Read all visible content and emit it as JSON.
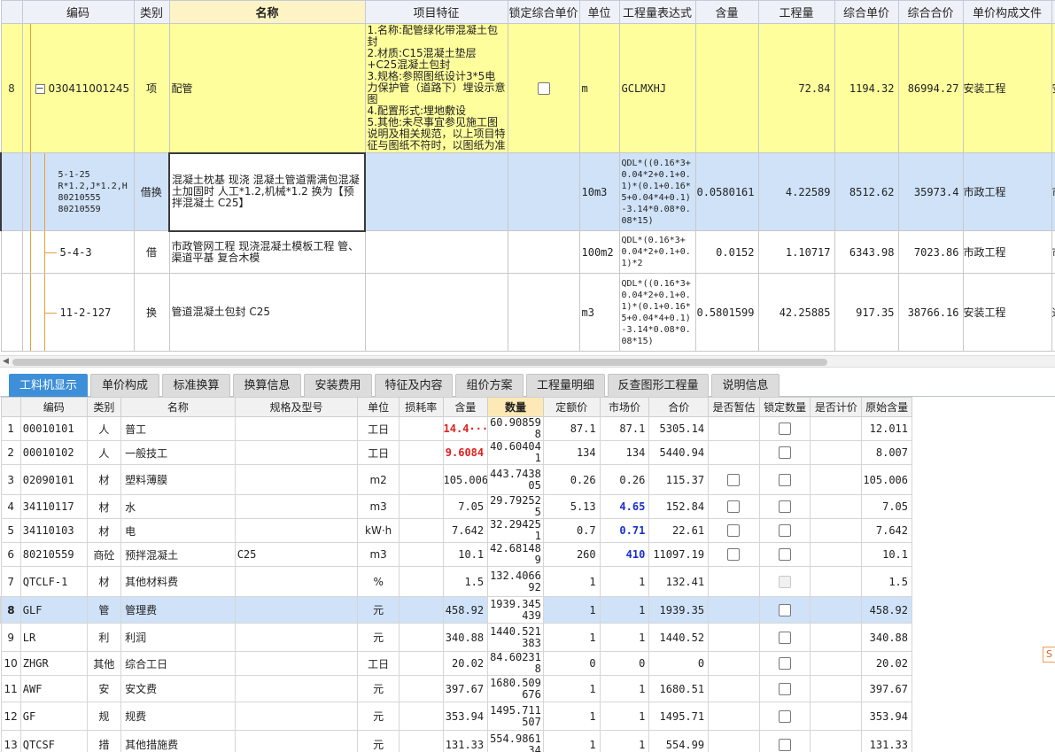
{
  "upper": {
    "headers": [
      "编码",
      "类别",
      "名称",
      "项目特征",
      "锁定综合单价",
      "单位",
      "工程量表达式",
      "含量",
      "工程量",
      "综合单价",
      "综合合价",
      "单价构成文件"
    ],
    "rows": [
      {
        "num": "8",
        "code": "030411001245",
        "category": "项",
        "name": "配管",
        "feature": "1.名称:配管绿化带混凝土包封\n2.材质:C15混凝土垫层+C25混凝土包封\n3.规格:参照图纸设计3*5电力保护管（道路下）埋设示意图\n4.配置形式:埋地敷设\n5.其他:未尽事宜参见施工图说明及相关规范，以上项目特征与图纸不符时，以图纸为准",
        "unit": "m",
        "expr": "GCLMXHJ",
        "content": "",
        "qty": "72.84",
        "price": "1194.32",
        "total": "86994.27",
        "file": "安装工程",
        "extra": "安"
      },
      {
        "num": "",
        "code": "5-1-25\nR*1.2,J*1.2,H\n80210555\n80210559",
        "category": "借换",
        "name": "混凝土枕基 现浇 混凝土管道需满包混凝土加固时 人工*1.2,机械*1.2 换为【预拌混凝土 C25】",
        "feature": "",
        "unit": "10m3",
        "expr": "QDL*((0.16*3+0.04*2+0.1+0.1)*(0.1+0.16*5+0.04*4+0.1)-3.14*0.08*0.08*15)",
        "content": "0.0580161",
        "qty": "4.22589",
        "price": "8512.62",
        "total": "35973.4",
        "file": "市政工程",
        "extra": "市"
      },
      {
        "num": "",
        "code": "5-4-3",
        "category": "借",
        "name": "市政管网工程 现浇混凝土模板工程 管、渠道平基 复合木模",
        "feature": "",
        "unit": "100m2",
        "expr": "QDL*(0.16*3+0.04*2+0.1+0.1)*2",
        "content": "0.0152",
        "qty": "1.10717",
        "price": "6343.98",
        "total": "7023.86",
        "file": "市政工程",
        "extra": "市"
      },
      {
        "num": "",
        "code": "11-2-127",
        "category": "换",
        "name": "管道混凝土包封 C25",
        "feature": "",
        "unit": "m3",
        "expr": "QDL*((0.16*3+0.04*2+0.1+0.1)*(0.1+0.16*5+0.04*4+0.1)-3.14*0.08*0.08*15)",
        "content": "0.5801599",
        "qty": "42.25885",
        "price": "917.35",
        "total": "38766.16",
        "file": "安装工程",
        "extra": "通"
      }
    ]
  },
  "tabs": [
    "工料机显示",
    "单价构成",
    "标准换算",
    "换算信息",
    "安装费用",
    "特征及内容",
    "组价方案",
    "工程量明细",
    "反查图形工程量",
    "说明信息"
  ],
  "lower": {
    "headers": [
      "编码",
      "类别",
      "名称",
      "规格及型号",
      "单位",
      "损耗率",
      "含量",
      "数量",
      "定额价",
      "市场价",
      "合价",
      "是否暂估",
      "锁定数量",
      "是否计价",
      "原始含量"
    ],
    "rows": [
      {
        "num": "1",
        "code": "00010101",
        "cat": "人",
        "name": "普工",
        "spec": "",
        "unit": "工日",
        "loss": "",
        "content": "14.4···",
        "qty": "60.908598",
        "quota": "87.1",
        "market": "87.1",
        "total": "5305.14",
        "est": "",
        "lock": "cb",
        "priced": "",
        "orig": "12.011"
      },
      {
        "num": "2",
        "code": "00010102",
        "cat": "人",
        "name": "一般技工",
        "spec": "",
        "unit": "工日",
        "loss": "",
        "content": "9.6084",
        "qty": "40.604041",
        "quota": "134",
        "market": "134",
        "total": "5440.94",
        "est": "",
        "lock": "cb",
        "priced": "",
        "orig": "8.007"
      },
      {
        "num": "3",
        "code": "02090101",
        "cat": "材",
        "name": "塑料薄膜",
        "spec": "",
        "unit": "m2",
        "loss": "",
        "content": "105.006",
        "qty": "443.743805",
        "quota": "0.26",
        "market": "0.26",
        "total": "115.37",
        "est": "cb",
        "lock": "cb",
        "priced": "",
        "orig": "105.006"
      },
      {
        "num": "4",
        "code": "34110117",
        "cat": "材",
        "name": "水",
        "spec": "",
        "unit": "m3",
        "loss": "",
        "content": "7.05",
        "qty": "29.792525",
        "quota": "5.13",
        "market": "4.65",
        "total": "152.84",
        "est": "cb",
        "lock": "cb",
        "priced": "",
        "orig": "7.05"
      },
      {
        "num": "5",
        "code": "34110103",
        "cat": "材",
        "name": "电",
        "spec": "",
        "unit": "kW·h",
        "loss": "",
        "content": "7.642",
        "qty": "32.294251",
        "quota": "0.7",
        "market": "0.71",
        "total": "22.61",
        "est": "cb",
        "lock": "cb",
        "priced": "",
        "orig": "7.642"
      },
      {
        "num": "6",
        "code": "80210559",
        "cat": "商砼",
        "name": "预拌混凝土",
        "spec": "C25",
        "unit": "m3",
        "loss": "",
        "content": "10.1",
        "qty": "42.681489",
        "quota": "260",
        "market": "410",
        "total": "11097.19",
        "est": "cb",
        "lock": "cb",
        "priced": "",
        "orig": "10.1"
      },
      {
        "num": "7",
        "code": "QTCLF-1",
        "cat": "材",
        "name": "其他材料费",
        "spec": "",
        "unit": "%",
        "loss": "",
        "content": "1.5",
        "qty": "132.406692",
        "quota": "1",
        "market": "1",
        "total": "132.41",
        "est": "",
        "lock": "dis",
        "priced": "",
        "orig": "1.5"
      },
      {
        "num": "8",
        "code": "GLF",
        "cat": "管",
        "name": "管理费",
        "spec": "",
        "unit": "元",
        "loss": "",
        "content": "458.92",
        "qty": "1939.345439",
        "quota": "1",
        "market": "1",
        "total": "1939.35",
        "est": "",
        "lock": "cb",
        "priced": "",
        "orig": "458.92"
      },
      {
        "num": "9",
        "code": "LR",
        "cat": "利",
        "name": "利润",
        "spec": "",
        "unit": "元",
        "loss": "",
        "content": "340.88",
        "qty": "1440.521383",
        "quota": "1",
        "market": "1",
        "total": "1440.52",
        "est": "",
        "lock": "cb",
        "priced": "",
        "orig": "340.88"
      },
      {
        "num": "10",
        "code": "ZHGR",
        "cat": "其他",
        "name": "综合工日",
        "spec": "",
        "unit": "工日",
        "loss": "",
        "content": "20.02",
        "qty": "84.602318",
        "quota": "0",
        "market": "0",
        "total": "0",
        "est": "",
        "lock": "cb",
        "priced": "",
        "orig": "20.02"
      },
      {
        "num": "11",
        "code": "AWF",
        "cat": "安",
        "name": "安文费",
        "spec": "",
        "unit": "元",
        "loss": "",
        "content": "397.67",
        "qty": "1680.509676",
        "quota": "1",
        "market": "1",
        "total": "1680.51",
        "est": "",
        "lock": "cb",
        "priced": "",
        "orig": "397.67"
      },
      {
        "num": "12",
        "code": "GF",
        "cat": "规",
        "name": "规费",
        "spec": "",
        "unit": "元",
        "loss": "",
        "content": "353.94",
        "qty": "1495.711507",
        "quota": "1",
        "market": "1",
        "total": "1495.71",
        "est": "",
        "lock": "cb",
        "priced": "",
        "orig": "353.94"
      },
      {
        "num": "13",
        "code": "QTCSF",
        "cat": "措",
        "name": "其他措施费",
        "spec": "",
        "unit": "元",
        "loss": "",
        "content": "131.33",
        "qty": "554.986134",
        "quota": "1",
        "market": "1",
        "total": "554.99",
        "est": "",
        "lock": "cb",
        "priced": "",
        "orig": "131.33"
      }
    ]
  },
  "colors": {
    "yellow_row": "#fffe9c",
    "selected_row": "#cfe2f8",
    "active_tab": "#3d8fd8",
    "highlight_red": "#e02020",
    "highlight_blue": "#1a2fd0"
  },
  "side_icon": "S"
}
